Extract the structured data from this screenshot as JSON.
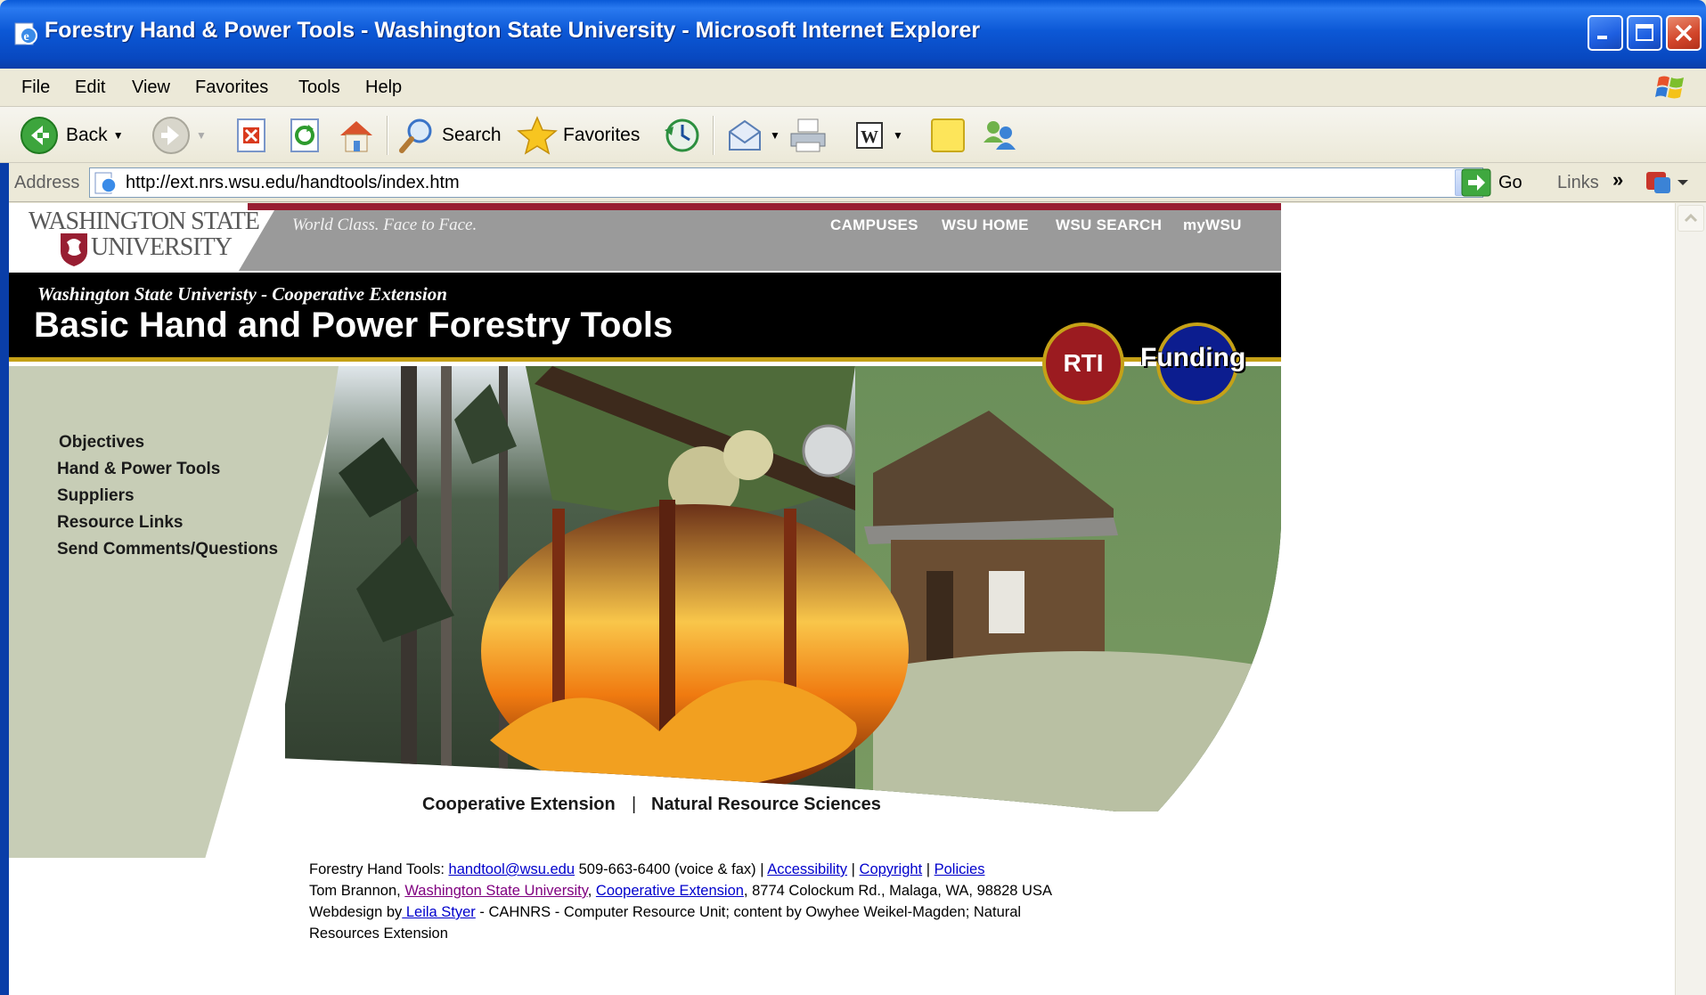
{
  "window": {
    "title": "Forestry Hand & Power Tools - Washington State University - Microsoft Internet Explorer"
  },
  "menu": [
    "File",
    "Edit",
    "View",
    "Favorites",
    "Tools",
    "Help"
  ],
  "toolbar": {
    "back": "Back",
    "search": "Search",
    "favorites": "Favorites"
  },
  "address": {
    "label": "Address",
    "url": "http://ext.nrs.wsu.edu/handtools/index.htm",
    "go": "Go",
    "links": "Links"
  },
  "wsu": {
    "logo_line1": "WASHINGTON STATE",
    "logo_line2": "UNIVERSITY",
    "tagline": "World Class. Face to Face.",
    "nav": [
      "CAMPUSES",
      "WSU HOME",
      "WSU SEARCH",
      "myWSU"
    ]
  },
  "banner": {
    "subtitle": "Washington State Univeristy - Cooperative Extension",
    "title": "Basic Hand and Power Forestry Tools",
    "rti": "RTI",
    "funding": "Funding"
  },
  "sidenav": [
    "Objectives",
    "Hand & Power Tools",
    "Suppliers",
    "Resource Links",
    "Send Comments/Questions"
  ],
  "units": {
    "left": "Cooperative Extension",
    "sep": "|",
    "right": "Natural Resource Sciences"
  },
  "footer": {
    "l1_prefix": "Forestry Hand Tools: ",
    "email": "handtool@wsu.edu",
    "l1_phone": " 509-663-6400 (voice & fax) | ",
    "accessibility": "Accessibility",
    "sep1": " | ",
    "copyright": "Copyright",
    "sep2": " | ",
    "policies": "Policies",
    "l2_prefix": "Tom Brannon, ",
    "wsu_link": "Washington State University",
    "comma": ", ",
    "coop_link": "Cooperative Extension",
    "l2_suffix": ", 8774 Colockum Rd., Malaga, WA, 98828 USA",
    "l3_prefix": "Webdesign by",
    "designer": " Leila Styer",
    "l3_suffix": " - CAHNRS - Computer Resource Unit; content by Owyhee Weikel-Magden; Natural",
    "l4": "Resources Extension"
  }
}
